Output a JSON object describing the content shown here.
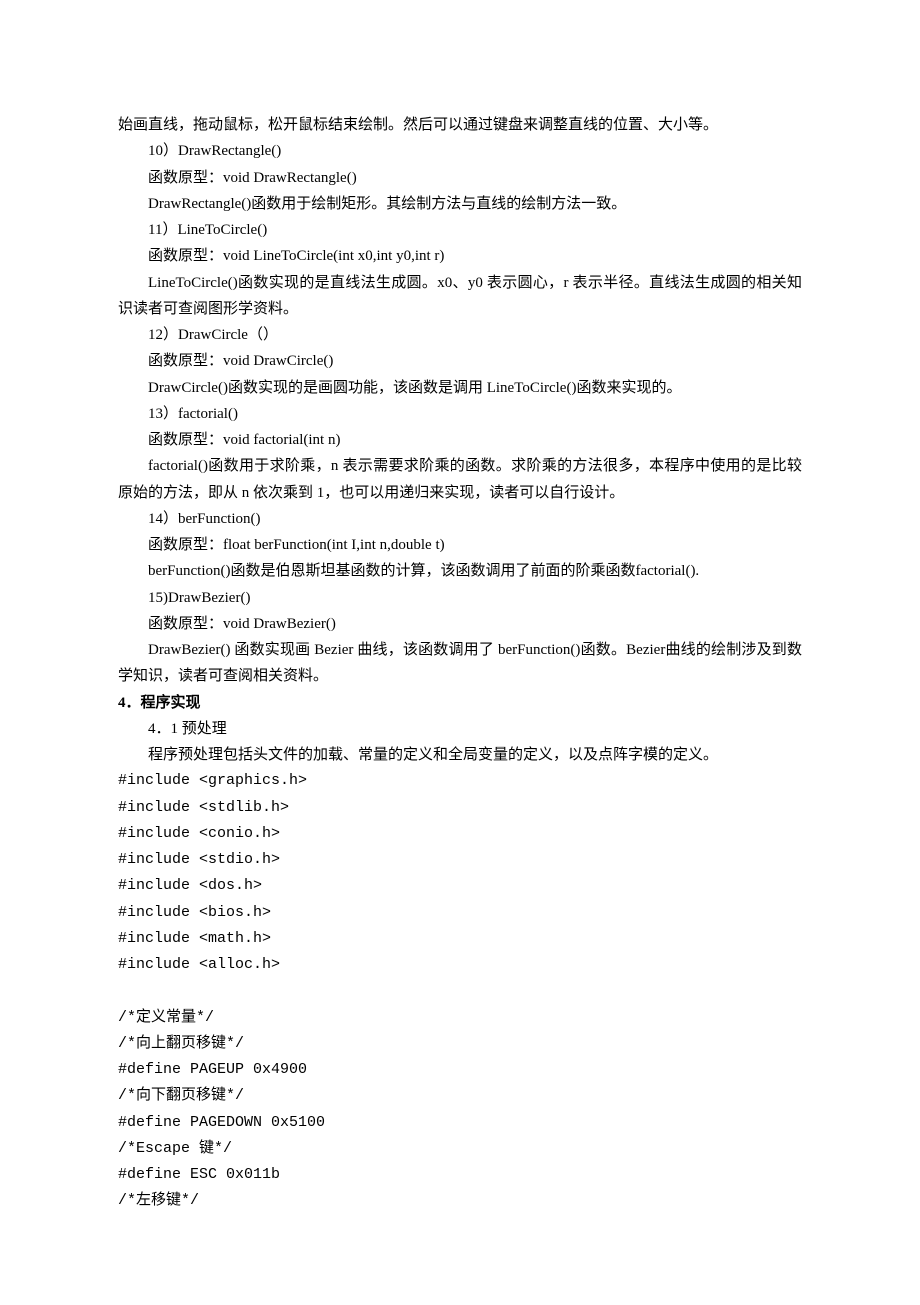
{
  "p01": "始画直线，拖动鼠标，松开鼠标结束绘制。然后可以通过键盘来调整直线的位置、大小等。",
  "p02": "10）DrawRectangle()",
  "p03": "函数原型：void DrawRectangle()",
  "p04": "DrawRectangle()函数用于绘制矩形。其绘制方法与直线的绘制方法一致。",
  "p05": "11）LineToCircle()",
  "p06": "函数原型：void LineToCircle(int x0,int y0,int r)",
  "p07": "LineToCircle()函数实现的是直线法生成圆。x0、y0 表示圆心，r 表示半径。直线法生成圆的相关知识读者可查阅图形学资料。",
  "p08": "12）DrawCircle（）",
  "p09": "函数原型：void DrawCircle()",
  "p10": "DrawCircle()函数实现的是画圆功能，该函数是调用 LineToCircle()函数来实现的。",
  "p11": "13）factorial()",
  "p12": "函数原型：void factorial(int n)",
  "p13": "factorial()函数用于求阶乘，n 表示需要求阶乘的函数。求阶乘的方法很多，本程序中使用的是比较原始的方法，即从 n 依次乘到 1，也可以用递归来实现，读者可以自行设计。",
  "p14": "14）berFunction()",
  "p15": "函数原型：float berFunction(int I,int n,double t)",
  "p16": "berFunction()函数是伯恩斯坦基函数的计算，该函数调用了前面的阶乘函数factorial().",
  "p17": "15)DrawBezier()",
  "p18": "函数原型：void DrawBezier()",
  "p19": "DrawBezier()  函数实现画 Bezier 曲线，该函数调用了 berFunction()函数。Bezier曲线的绘制涉及到数学知识，读者可查阅相关资料。",
  "h4": "4．程序实现",
  "h41": "4．1 预处理",
  "p20": "程序预处理包括头文件的加载、常量的定义和全局变量的定义，以及点阵字模的定义。",
  "c01": "#include <graphics.h>",
  "c02": "#include <stdlib.h>",
  "c03": "#include <conio.h>",
  "c04": "#include <stdio.h>",
  "c05": "#include <dos.h>",
  "c06": "#include <bios.h>",
  "c07": "#include <math.h>",
  "c08": "#include <alloc.h>",
  "c09": "",
  "c10": "/*定义常量*/",
  "c11": "/*向上翻页移键*/",
  "c12": "#define PAGEUP 0x4900",
  "c13": "/*向下翻页移键*/",
  "c14": "#define PAGEDOWN 0x5100",
  "c15": "/*Escape 键*/",
  "c16": "#define ESC 0x011b",
  "c17": "/*左移键*/"
}
